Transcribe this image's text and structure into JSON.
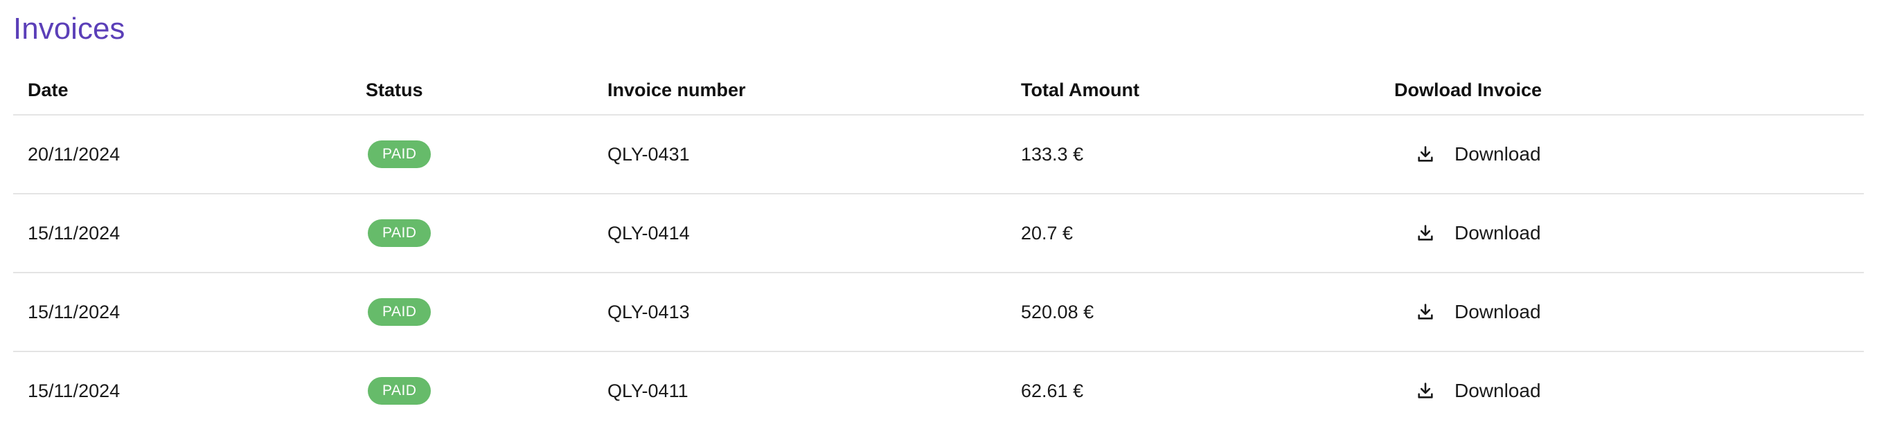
{
  "page": {
    "title": "Invoices"
  },
  "table": {
    "headers": {
      "date": "Date",
      "status": "Status",
      "invoice_number": "Invoice number",
      "total_amount": "Total Amount",
      "download": "Dowload Invoice"
    },
    "rows": [
      {
        "date": "20/11/2024",
        "status": "PAID",
        "invoice_number": "QLY-0431",
        "total_amount": "133.3 €",
        "download_label": "Download"
      },
      {
        "date": "15/11/2024",
        "status": "PAID",
        "invoice_number": "QLY-0414",
        "total_amount": "20.7 €",
        "download_label": "Download"
      },
      {
        "date": "15/11/2024",
        "status": "PAID",
        "invoice_number": "QLY-0413",
        "total_amount": "520.08 €",
        "download_label": "Download"
      },
      {
        "date": "15/11/2024",
        "status": "PAID",
        "invoice_number": "QLY-0411",
        "total_amount": "62.61 €",
        "download_label": "Download"
      }
    ]
  },
  "icons": {
    "download": "download-icon"
  },
  "colors": {
    "title": "#5b3fb8",
    "paid_badge": "#66bb6a",
    "divider": "#e4e4e4"
  }
}
